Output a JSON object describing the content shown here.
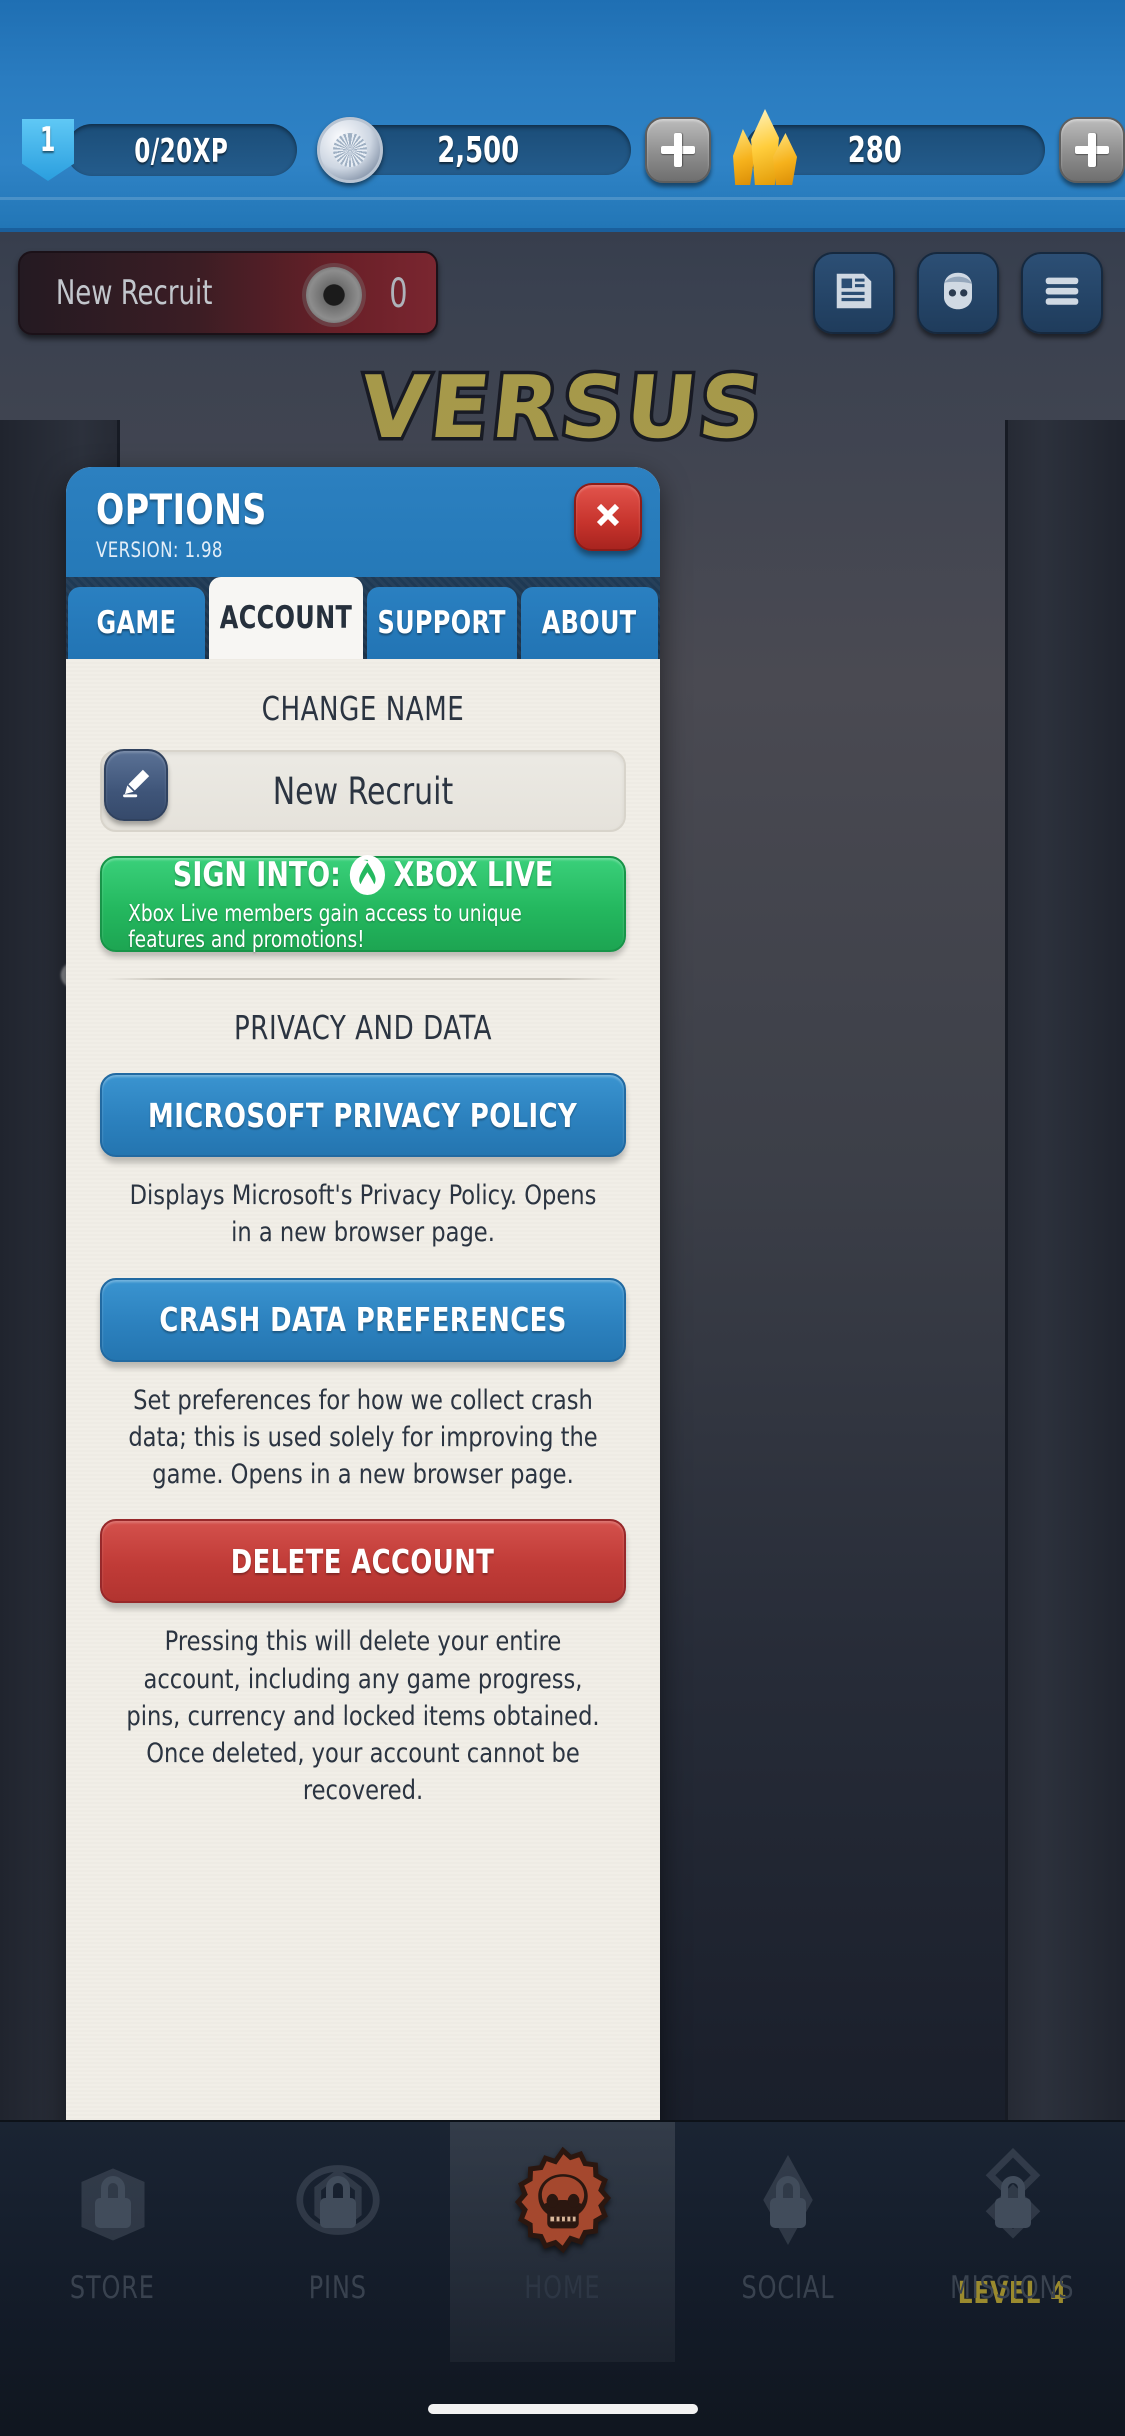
{
  "topbar": {
    "level": "1",
    "xp": "0/20XP",
    "coins": "2,500",
    "crystals": "280",
    "coin_icon": "coin-icon",
    "crystal_icon": "crystal-icon",
    "add_coins_label": "+",
    "add_crystals_label": "+"
  },
  "nav": {
    "player_name": "New Recruit",
    "player_badge_count": "0",
    "news_icon": "news-icon",
    "avatar_icon": "character-icon",
    "menu_icon": "hamburger-menu-icon"
  },
  "background": {
    "versus_text": "VERSUS"
  },
  "dialog": {
    "title": "OPTIONS",
    "version": "VERSION: 1.98",
    "close_icon": "close-icon",
    "tabs": [
      {
        "label": "GAME",
        "active": false
      },
      {
        "label": "ACCOUNT",
        "active": true
      },
      {
        "label": "SUPPORT",
        "active": false
      },
      {
        "label": "ABOUT",
        "active": false
      }
    ],
    "change_name": {
      "heading": "CHANGE NAME",
      "value": "New Recruit",
      "edit_icon": "pencil-icon"
    },
    "xbox": {
      "line1_prefix": "SIGN INTO:",
      "line1_brand": "XBOX LIVE",
      "logo_icon": "xbox-logo-icon",
      "line2": "Xbox Live members gain access to unique features and promotions!",
      "color": "#24b85f"
    },
    "privacy": {
      "heading": "PRIVACY AND DATA",
      "items": [
        {
          "label": "MICROSOFT PRIVACY POLICY",
          "style": "blue",
          "description": "Displays Microsoft's Privacy Policy. Opens in a new browser page."
        },
        {
          "label": "CRASH DATA PREFERENCES",
          "style": "blue",
          "description": "Set preferences for how we collect crash data; this is used solely for improving the game. Opens in a new browser page."
        },
        {
          "label": "DELETE ACCOUNT",
          "style": "red",
          "description": "Pressing this will delete your entire account, including any game progress, pins, currency and locked items obtained. Once deleted, your account cannot be recovered."
        }
      ]
    },
    "colors": {
      "header_blue": "#2579b8",
      "button_blue": "#2c81be",
      "button_red": "#c03b37",
      "close_red": "#c6332c"
    }
  },
  "bottom_nav": [
    {
      "label": "STORE",
      "icon": "store-icon",
      "locked": true,
      "active": false,
      "badge": ""
    },
    {
      "label": "PINS",
      "icon": "pins-icon",
      "locked": true,
      "active": false,
      "badge": ""
    },
    {
      "label": "HOME",
      "icon": "skull-gear-icon",
      "locked": false,
      "active": true,
      "badge": ""
    },
    {
      "label": "SOCIAL",
      "icon": "social-icon",
      "locked": true,
      "active": false,
      "badge": ""
    },
    {
      "label": "MISSIONS",
      "icon": "missions-icon",
      "locked": true,
      "active": false,
      "badge": "LEVEL 4"
    }
  ]
}
